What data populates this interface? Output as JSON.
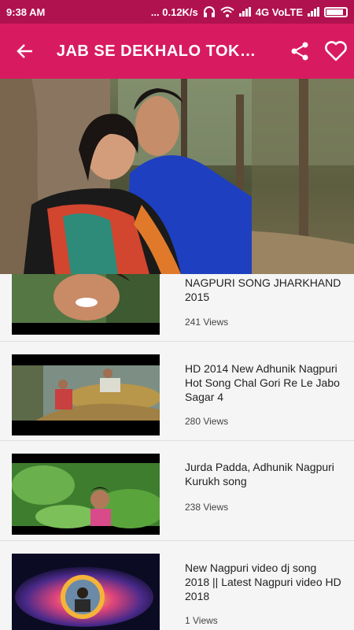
{
  "status_bar": {
    "time": "9:38 AM",
    "speed": "... 0.12K/s",
    "network": "4G VoLTE"
  },
  "app_bar": {
    "title": "JAB SE DEKHALO TOKE ...",
    "back_icon": "arrow-back-icon",
    "share_icon": "share-icon",
    "favorite_icon": "heart-outline-icon"
  },
  "colors": {
    "status_bar": "#b0124f",
    "app_bar": "#d81b60"
  },
  "videos": [
    {
      "title": "NAGPURI SONG JHARKHAND 2015",
      "views": "241 Views"
    },
    {
      "title": "HD 2014 New Adhunik Nagpuri Hot Song    Chal Gori Re Le Jabo    Sagar 4",
      "views": "280 Views"
    },
    {
      "title": "Jurda Padda, Adhunik Nagpuri Kurukh song",
      "views": "238 Views"
    },
    {
      "title": "New Nagpuri video dj song 2018 || Latest Nagpuri video HD 2018",
      "views": "1 Views"
    }
  ]
}
